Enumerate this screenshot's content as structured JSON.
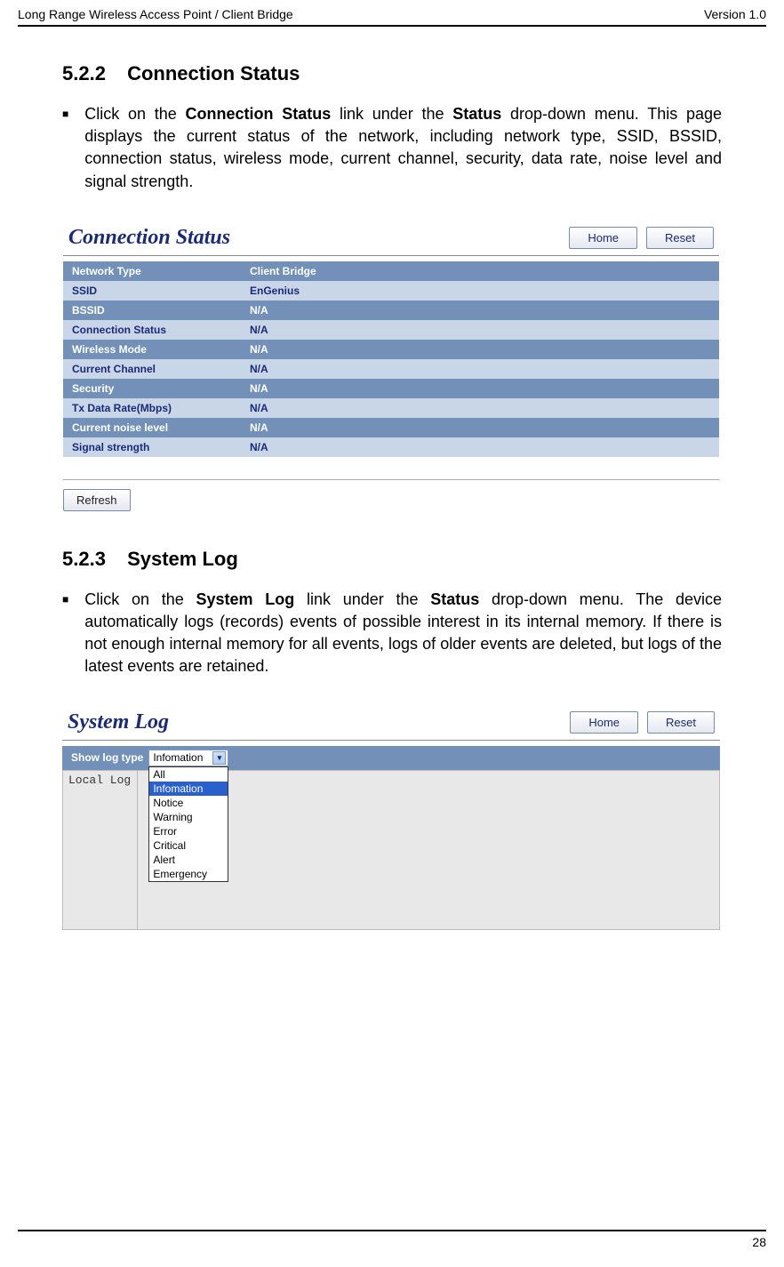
{
  "header": {
    "left": "Long Range Wireless Access Point / Client Bridge",
    "right": "Version 1.0"
  },
  "section1": {
    "num": "5.2.2",
    "title": "Connection Status",
    "para_pre": "Click on the ",
    "para_b1": "Connection Status",
    "para_mid1": " link under the ",
    "para_b2": "Status",
    "para_post": " drop-down menu. This page displays the current status of the network, including network type, SSID,  BSSID, connection status, wireless mode, current channel, security, data rate, noise level and signal strength."
  },
  "connStatus": {
    "title": "Connection Status",
    "btnHome": "Home",
    "btnReset": "Reset",
    "rows": [
      {
        "k": "Network Type",
        "v": "Client Bridge"
      },
      {
        "k": "SSID",
        "v": "EnGenius"
      },
      {
        "k": "BSSID",
        "v": "N/A"
      },
      {
        "k": "Connection Status",
        "v": "N/A"
      },
      {
        "k": "Wireless Mode",
        "v": "N/A"
      },
      {
        "k": "Current Channel",
        "v": "N/A"
      },
      {
        "k": "Security",
        "v": "N/A"
      },
      {
        "k": "Tx Data Rate(Mbps)",
        "v": "N/A"
      },
      {
        "k": "Current noise level",
        "v": "N/A"
      },
      {
        "k": "Signal strength",
        "v": "N/A"
      }
    ],
    "btnRefresh": "Refresh"
  },
  "section2": {
    "num": "5.2.3",
    "title": "System Log",
    "para_pre": "Click on the ",
    "para_b1": "System Log",
    "para_mid1": " link under the ",
    "para_b2": "Status",
    "para_post": " drop-down menu. The device automatically logs (records) events of possible interest in its internal memory. If there is not enough internal memory for all events, logs of older events are deleted, but logs of the latest events are retained."
  },
  "sysLog": {
    "title": "System Log",
    "btnHome": "Home",
    "btnReset": "Reset",
    "rowLabel": "Show log type",
    "selected": "Infomation",
    "options": [
      "All",
      "Infomation",
      "Notice",
      "Warning",
      "Error",
      "Critical",
      "Alert",
      "Emergency"
    ],
    "logLeft": "Local Log"
  },
  "footer": {
    "pageNum": "28"
  }
}
